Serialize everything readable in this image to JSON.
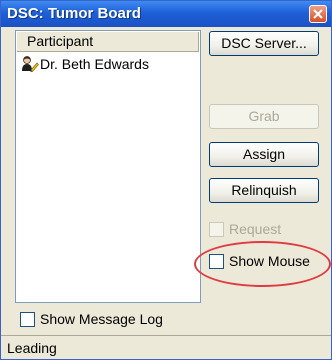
{
  "window": {
    "title": "DSC: Tumor Board"
  },
  "participants": {
    "header": "Participant",
    "items": [
      {
        "name": "Dr. Beth Edwards",
        "icon": "user-pencil-icon"
      }
    ]
  },
  "buttons": {
    "dsc_server": "DSC Server...",
    "grab": "Grab",
    "assign": "Assign",
    "relinquish": "Relinquish"
  },
  "checkboxes": {
    "request": {
      "label": "Request",
      "checked": false,
      "enabled": false
    },
    "show_mouse": {
      "label": "Show Mouse",
      "checked": false,
      "enabled": true
    },
    "show_message_log": {
      "label": "Show Message Log",
      "checked": false,
      "enabled": true
    }
  },
  "status": {
    "text": "Leading"
  },
  "colors": {
    "titlebar": "#1f5fd8",
    "window_bg": "#ece9d8",
    "highlight": "#e03b43",
    "close_button": "#d4502a"
  }
}
